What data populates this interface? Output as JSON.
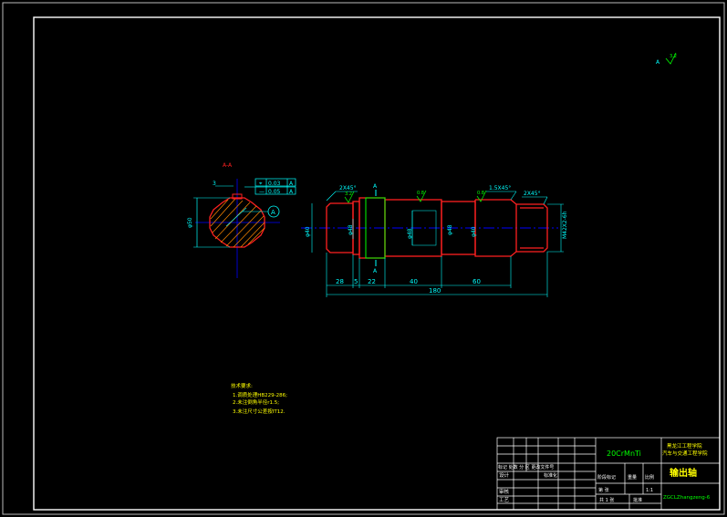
{
  "drawing": {
    "corner_label": "A",
    "corner_mark": "3.2",
    "section_label": "A-A",
    "section_ref": "A",
    "keyway_label": "3",
    "diameter_label": "φ50",
    "tolerance_frame": {
      "row1_symbol": "⌖",
      "row1_value": "0.03",
      "row1_datum": "A",
      "row2_symbol": "—",
      "row2_value": "0.05",
      "row2_datum": "A"
    },
    "chamfers": [
      "2X45°",
      "1.5X45°",
      "2X45°"
    ],
    "roughness": [
      "3.2",
      "0.8",
      "0.8"
    ],
    "dims": {
      "d1": "φ40",
      "d2": "φ48",
      "d3": "φ48",
      "d4": "φ48",
      "d5": "φ40",
      "d6": "M42X2-6h",
      "l1": "28",
      "l2": "5",
      "l3": "22",
      "l4": "40",
      "l5": "60",
      "total": "180"
    },
    "section_marks": [
      "A",
      "A"
    ],
    "tech_req": {
      "title": "技术要求:",
      "items": [
        "1.调质处理HB229-286;",
        "2.未注倒角半径r1.5;",
        "3.未注尺寸公差按IT12."
      ]
    }
  },
  "title_block": {
    "material": "20CrMnTi",
    "school_line1": "黑龙江工程学院",
    "school_line2": "汽车与交通工程学院",
    "part_name": "输出轴",
    "drawing_no": "ZGCLZhangzeng-6",
    "row_marks": "标记 处数 分 区 更改文件号",
    "design": "设计",
    "review": "审核",
    "process": "工艺",
    "std": "标准化",
    "stage": "阶段标记",
    "weight": "重量",
    "scale": "比例",
    "scale_value": "1:1",
    "sheets": "共 1 张",
    "sheet": "第 张",
    "approve": "批准"
  }
}
